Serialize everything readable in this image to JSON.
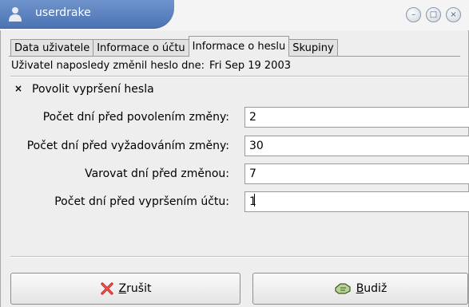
{
  "window": {
    "title": "userdrake",
    "controls": [
      "minimize-icon",
      "maximize-icon",
      "close-icon"
    ]
  },
  "tabs": [
    {
      "label": "Data uživatele",
      "active": false
    },
    {
      "label": "Informace o účtu",
      "active": false
    },
    {
      "label": "Informace o heslu",
      "active": true
    },
    {
      "label": "Skupiny",
      "active": false
    }
  ],
  "last_changed": {
    "label": "Uživatel naposledy změnil heslo dne:",
    "value": "Fri Sep 19 2003"
  },
  "expiry": {
    "checked": true,
    "mark": "×",
    "label": "Povolit vypršení hesla"
  },
  "fields": [
    {
      "label": "Počet dní před povolením změny:",
      "value": "2"
    },
    {
      "label": "Počet dní před vyžadováním změny:",
      "value": "30"
    },
    {
      "label": "Varovat dní před změnou:",
      "value": "7"
    },
    {
      "label": "Počet dní před vypršením účtu:",
      "value": "1"
    }
  ],
  "buttons": {
    "cancel": {
      "mnemonic": "Z",
      "rest": "rušit",
      "icon": "cancel-x-icon"
    },
    "ok": {
      "mnemonic": "B",
      "rest": "udiž",
      "icon": "ok-hand-icon"
    }
  },
  "colors": {
    "titlebar_accent": "#5b80bd",
    "window_bg": "#eeeeee"
  }
}
